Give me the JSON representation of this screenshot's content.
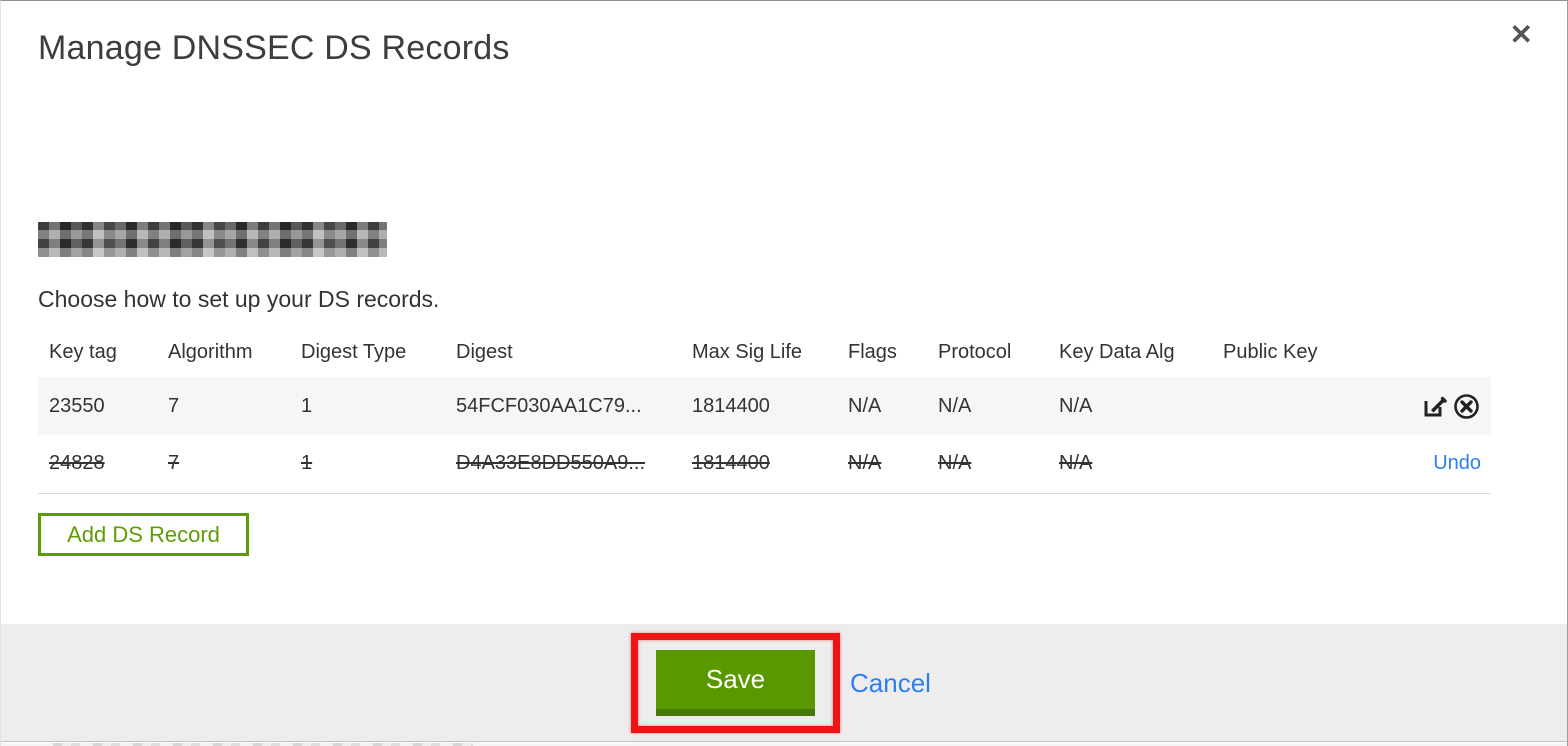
{
  "modal": {
    "title": "Manage DNSSEC DS Records",
    "close_glyph": "✕",
    "instruction": "Choose how to set up your DS records.",
    "add_button_label": "Add DS Record",
    "save_label": "Save",
    "cancel_label": "Cancel",
    "undo_label": "Undo"
  },
  "table": {
    "headers": [
      "Key tag",
      "Algorithm",
      "Digest Type",
      "Digest",
      "Max Sig Life",
      "Flags",
      "Protocol",
      "Key Data Alg",
      "Public Key"
    ],
    "rows": [
      {
        "key_tag": "23550",
        "algorithm": "7",
        "digest_type": "1",
        "digest": "54FCF030AA1C79...",
        "max_sig_life": "1814400",
        "flags": "N/A",
        "protocol": "N/A",
        "key_data_alg": "N/A",
        "public_key": "",
        "state": "current"
      },
      {
        "key_tag": "24828",
        "algorithm": "7",
        "digest_type": "1",
        "digest": "D4A33E8DD550A9...",
        "max_sig_life": "1814400",
        "flags": "N/A",
        "protocol": "N/A",
        "key_data_alg": "N/A",
        "public_key": "",
        "state": "removed"
      }
    ]
  },
  "icons": {
    "edit": "edit-pencil-square",
    "delete": "delete-circle-x",
    "close": "close-x"
  },
  "colors": {
    "accent_green": "#5e9c06",
    "save_green": "#5a9800",
    "link_blue": "#2d7ff0",
    "annotation_red": "#ee1414",
    "row_highlight": "#f6f6f6",
    "footer_gray": "#ededed"
  }
}
